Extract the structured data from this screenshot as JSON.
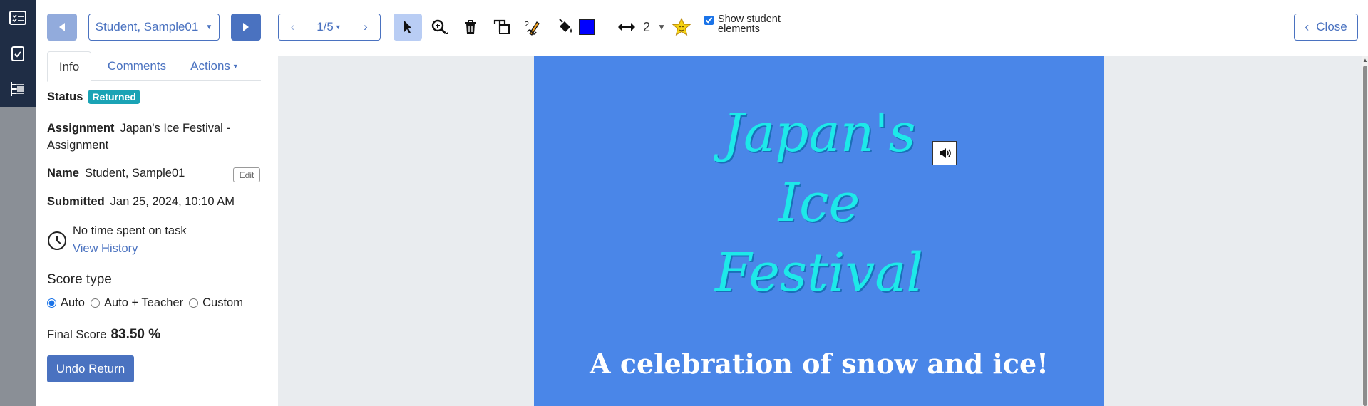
{
  "toolbar": {
    "student_name": "Student, Sample01",
    "page_label": "1/5",
    "stroke_width": "2",
    "show_elements_label": "Show student elements",
    "show_elements_checked": true,
    "fill_color": "#0000ff",
    "close_label": "Close"
  },
  "rail": {
    "icons": [
      "checklist-icon",
      "clipboard-check-icon",
      "outline-tree-icon"
    ]
  },
  "panel": {
    "tabs": [
      {
        "label": "Info",
        "active": true
      },
      {
        "label": "Comments",
        "active": false
      },
      {
        "label": "Actions",
        "active": false
      }
    ],
    "status_label": "Status",
    "status_value": "Returned",
    "assignment_label": "Assignment",
    "assignment_value": "Japan's Ice Festival - Assignment",
    "name_label": "Name",
    "name_value": "Student, Sample01",
    "edit_label": "Edit",
    "submitted_label": "Submitted",
    "submitted_value": "Jan 25, 2024, 10:10 AM",
    "time_text": "No time spent on task",
    "history_link": "View History",
    "score_type_heading": "Score type",
    "score_types": [
      {
        "label": "Auto",
        "checked": true
      },
      {
        "label": "Auto + Teacher",
        "checked": false
      },
      {
        "label": "Custom",
        "checked": false
      }
    ],
    "final_score_label": "Final Score",
    "final_score_value": "83.50 %",
    "undo_label": "Undo Return"
  },
  "slide": {
    "title_lines": [
      "Japan's",
      "Ice",
      "Festival"
    ],
    "subtitle": "A celebration of snow and ice!",
    "background": "#4a86e8",
    "title_color": "#1de9e9"
  }
}
